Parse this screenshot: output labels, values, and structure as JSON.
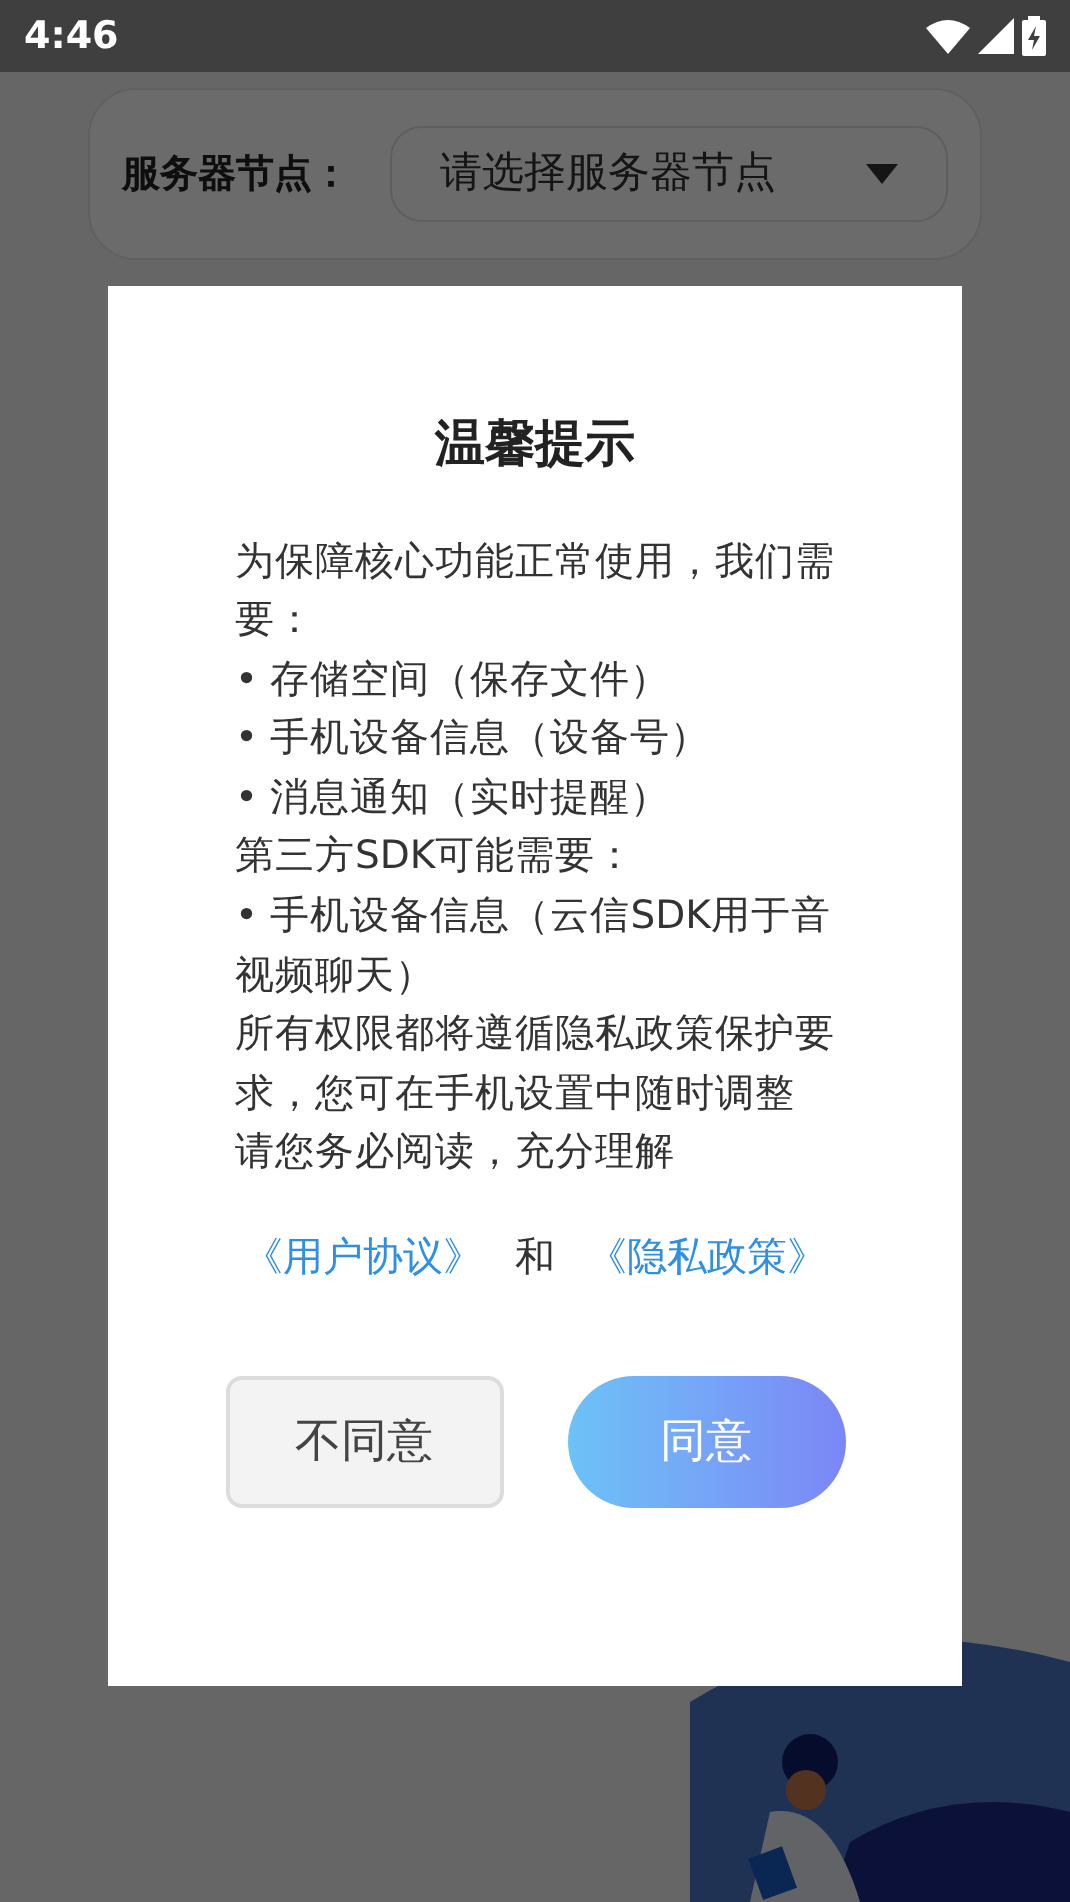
{
  "status_bar": {
    "time": "4:46"
  },
  "server_node": {
    "label": "服务器节点：",
    "placeholder": "请选择服务器节点"
  },
  "dialog": {
    "title": "温馨提示",
    "paragraphs": [
      "为保障核心功能正常使用，我们需要：",
      "• 存储空间（保存文件）",
      "• 手机设备信息（设备号）",
      "• 消息通知（实时提醒）",
      "第三方SDK可能需要：",
      "• 手机设备信息（云信SDK用于音视频聊天）",
      "所有权限都将遵循隐私政策保护要求，您可在手机设置中随时调整",
      "请您务必阅读，充分理解"
    ],
    "links": [
      {
        "kind": "link",
        "text": "《用户协议》"
      },
      {
        "kind": "text",
        "text": "和"
      },
      {
        "kind": "link",
        "text": "《隐私政策》"
      }
    ],
    "buttons": [
      {
        "kind": "secondary",
        "label": "不同意"
      },
      {
        "kind": "primary",
        "label": "同意"
      }
    ]
  }
}
